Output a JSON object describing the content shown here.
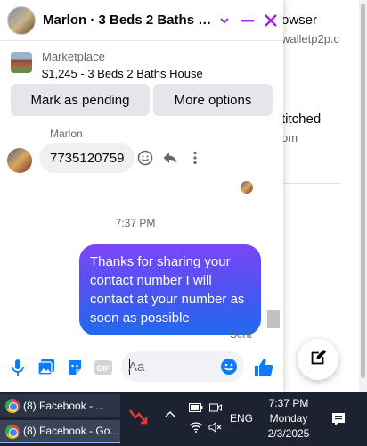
{
  "background": {
    "item1_title": "owser",
    "item1_sub": "walletp2p.c",
    "item2_title": "titched",
    "item2_sub": "om"
  },
  "chat": {
    "header_title": "Marlon · 3 Beds 2 Baths H...",
    "marketplace_label": "Marketplace",
    "listing_title": "$1,245 - 3 Beds 2 Baths House",
    "mark_pending_label": "Mark as pending",
    "more_options_label": "More options",
    "sender_name": "Marlon",
    "incoming_message": "7735120759",
    "timestamp": "7:37 PM",
    "outgoing_message": "Thanks for sharing your contact number I will contact at your number as soon as possible",
    "sent_status": "Sent",
    "input_placeholder": "Aa",
    "accent_color": "#a020f0",
    "link_color": "#0a7cff"
  },
  "taskbar": {
    "item1_label": "(8) Facebook - ...",
    "item2_label": "(8) Facebook - Go...",
    "language": "ENG",
    "time": "7:37 PM",
    "day": "Monday",
    "date": "2/3/2025"
  }
}
